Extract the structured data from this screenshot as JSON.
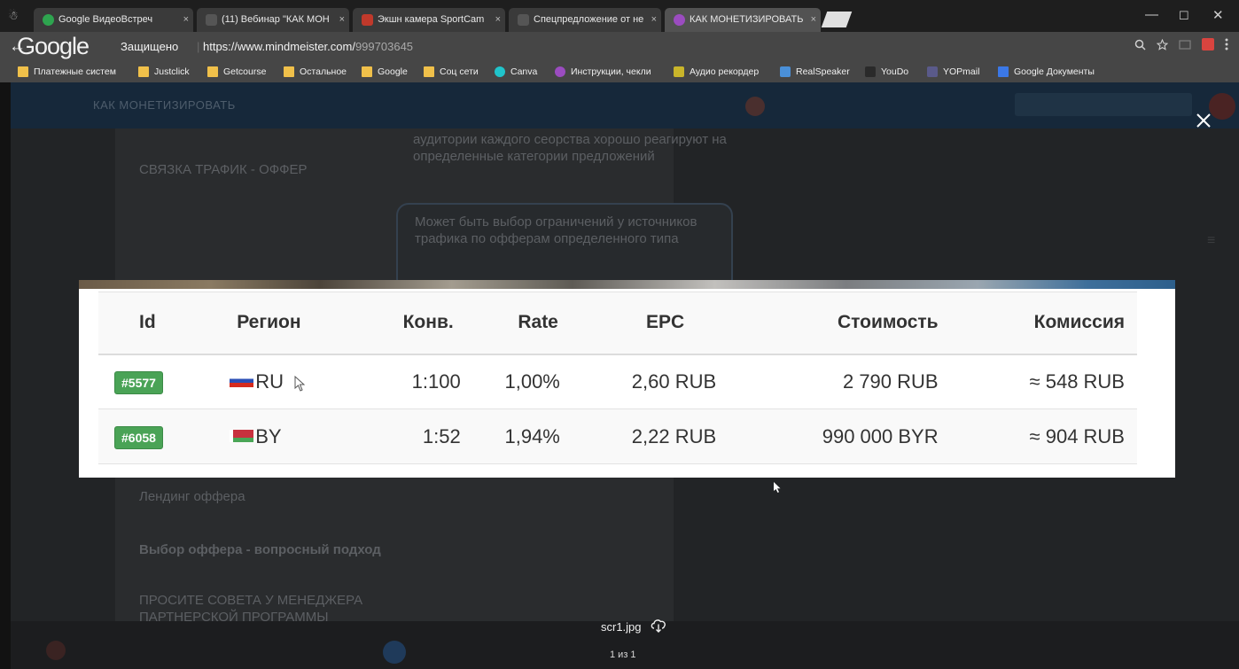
{
  "browser": {
    "incognito_glyph": "☃",
    "tabs": [
      {
        "label": "Google ВидеоВстреч",
        "favicon_color": "#2ea44f",
        "active": false
      },
      {
        "label": "(11) Вебинар \"КАК МОН",
        "favicon_color": "#555555",
        "active": false
      },
      {
        "label": "Экшн камера SportCam",
        "favicon_color": "#c0392b",
        "active": false
      },
      {
        "label": "Спецпредложение от не",
        "favicon_color": "#555555",
        "active": false
      },
      {
        "label": "КАК МОНЕТИЗИРОВАТЬ",
        "favicon_color": "#9b4cc0",
        "active": true
      }
    ],
    "tab_close_glyph": "×",
    "window_controls": [
      "—",
      "☐",
      "✕"
    ]
  },
  "addressbar": {
    "back_glyph": "←",
    "logo": "Google",
    "secure_label": "Защищено",
    "url_host": "https://www.mindmeister.com/",
    "url_path": "999703645"
  },
  "bookmarks": [
    {
      "label": "Платежные систем",
      "icon": "folder-icon"
    },
    {
      "label": "Justclick",
      "icon": "folder-icon"
    },
    {
      "label": "Getcourse",
      "icon": "folder-icon"
    },
    {
      "label": "Остальное",
      "icon": "folder-icon"
    },
    {
      "label": "Google",
      "icon": "folder-icon"
    },
    {
      "label": "Соц сети",
      "icon": "folder-icon"
    },
    {
      "label": "Canva",
      "icon": "canva-icon"
    },
    {
      "label": "Инструкции, чекли",
      "icon": "instructions-icon"
    },
    {
      "label": "Аудио рекордер",
      "icon": "recorder-icon"
    },
    {
      "label": "RealSpeaker",
      "icon": "realspeaker-icon"
    },
    {
      "label": "YouDo",
      "icon": "youdo-icon"
    },
    {
      "label": "YOPmail",
      "icon": "yopmail-icon"
    },
    {
      "label": "Google Документы",
      "icon": "google-docs-icon"
    }
  ],
  "background_page": {
    "app_title": "КАК МОНЕТИЗИРОВАТЬ",
    "node_top_text": "аудитории каждого сеорства хорошо реагируют на определенные категории предложений",
    "node_text": "Может быть выбор ограничений у источников трафика по офферам определенного типа",
    "branch_label": "СВЯЗКА ТРАФИК - ОФФЕР",
    "landing_label": "Лендинг оффера",
    "choice_label": "Выбор оффера - вопросный подход",
    "advice_label": "ПРОСИТЕ СОВЕТА У МЕНЕДЖЕРА ПАРТНЕРСКОЙ ПРОГРАММЫ",
    "hamburger_glyph": "≡"
  },
  "viewer": {
    "filename": "scr1.jpg",
    "counter": "1 из 1",
    "close_glyph": "×",
    "table": {
      "headers": {
        "id": "Id",
        "region": "Регион",
        "conv": "Конв.",
        "rate": "Rate",
        "epc": "EPC",
        "cost": "Стоимость",
        "commission": "Комиссия"
      },
      "rows": [
        {
          "id": "#5577",
          "region": "RU",
          "conv": "1:100",
          "rate": "1,00%",
          "epc": "2,60 RUB",
          "cost": "2 790 RUB",
          "commission": "≈ 548 RUB"
        },
        {
          "id": "#6058",
          "region": "BY",
          "conv": "1:52",
          "rate": "1,94%",
          "epc": "2,22 RUB",
          "cost": "990 000 BYR",
          "commission": "≈ 904 RUB"
        }
      ]
    }
  },
  "colors": {
    "badge_green": "#4aa356",
    "app_bar": "#16283a"
  }
}
